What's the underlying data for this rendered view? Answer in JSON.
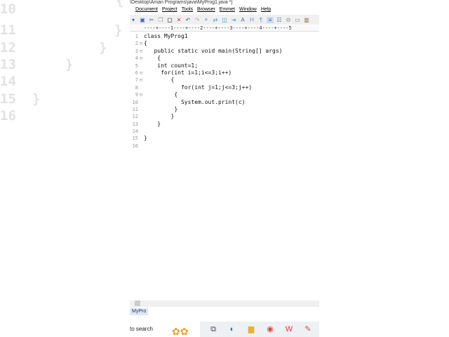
{
  "background": {
    "line_numbers": [
      "10",
      "11",
      "12",
      "13",
      "14",
      "15",
      "16"
    ],
    "braces": [
      "{",
      "}",
      "}",
      "}",
      "}"
    ]
  },
  "window": {
    "title": "\\Desktop\\Aman Programs\\java\\MyProg1.java *]"
  },
  "menu": [
    "Document",
    "Project",
    "Tools",
    "Browser",
    "Emmet",
    "Window",
    "Help"
  ],
  "ruler": "----+----1----+----2----+----3----+----4----+----5",
  "code": [
    {
      "n": "1",
      "fold": "",
      "html": "class MyProg1"
    },
    {
      "n": "2",
      "fold": "⊟",
      "html": "{"
    },
    {
      "n": "3",
      "fold": "⊟",
      "html": "   public static void main(String[] args)"
    },
    {
      "n": "4",
      "fold": "⊟",
      "html": "    {"
    },
    {
      "n": "5",
      "fold": "",
      "html": "    int count=1;"
    },
    {
      "n": "6",
      "fold": "⊟",
      "html": "     for(int i=1;i<=3;i++)"
    },
    {
      "n": "7",
      "fold": "⊟",
      "html": "        {"
    },
    {
      "n": "8",
      "fold": "",
      "html": "           for(int j=1;j<=3;j++)"
    },
    {
      "n": "9",
      "fold": "⊟",
      "html": "         {"
    },
    {
      "n": "10",
      "fold": "",
      "html": "           System.out.print(c)"
    },
    {
      "n": "11",
      "fold": "",
      "html": "         }"
    },
    {
      "n": "12",
      "fold": "",
      "html": "        }"
    },
    {
      "n": "13",
      "fold": "",
      "html": "    }"
    },
    {
      "n": "14",
      "fold": "",
      "html": ""
    },
    {
      "n": "15",
      "fold": "",
      "html": "}"
    },
    {
      "n": "16",
      "fold": "",
      "html": ""
    }
  ],
  "doc_tab": "MyPro",
  "taskbar": {
    "search_placeholder": "to search"
  }
}
